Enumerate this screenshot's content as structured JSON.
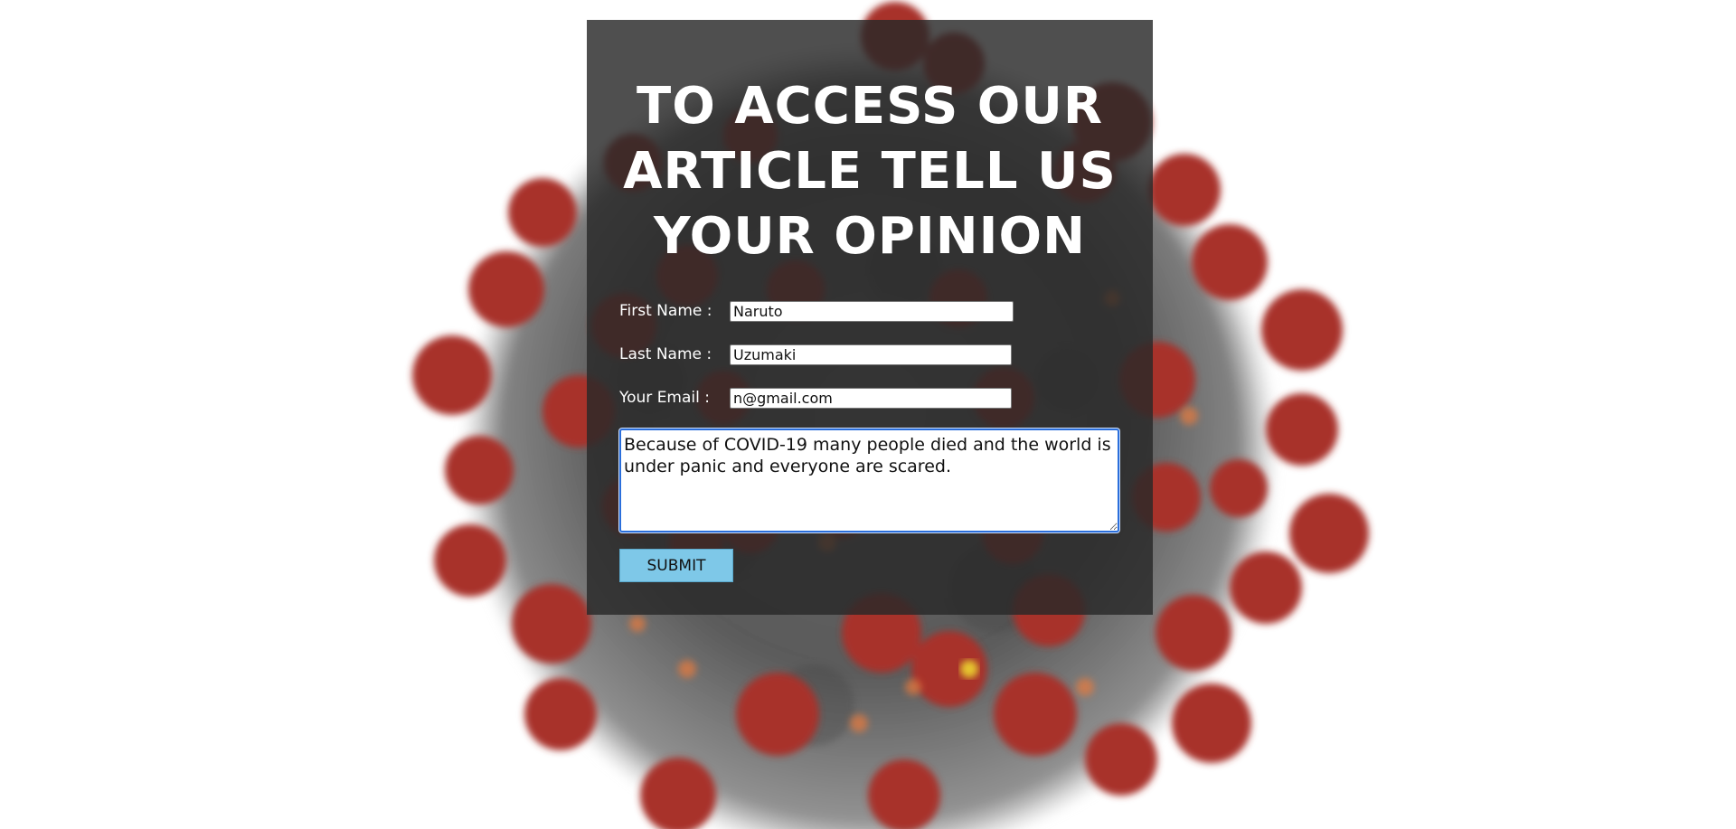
{
  "colors": {
    "panel_bg": "#282828",
    "title_text": "#ffffff",
    "submit_bg": "#7ec8e8",
    "textarea_focus_border": "#2a6edb",
    "virus_spike": "#a8322c",
    "virus_body": "#8a8a8a"
  },
  "background": {
    "image_subject": "coronavirus-illustration"
  },
  "form": {
    "title": "TO ACCESS OUR ARTICLE TELL US YOUR OPINION",
    "title_lines": [
      "TO ACCESS OUR",
      "ARTICLE TELL US",
      "YOUR OPINION"
    ],
    "first_name_label": "First Name :",
    "first_name_value": "Naruto",
    "last_name_label": "Last Name :",
    "last_name_value": "Uzumaki",
    "email_label": "Your Email :",
    "email_value": "n@gmail.com",
    "opinion_value": "Because of COVID-19 many people died and the world is under panic and everyone are scared.",
    "submit_label": "SUBMIT"
  }
}
